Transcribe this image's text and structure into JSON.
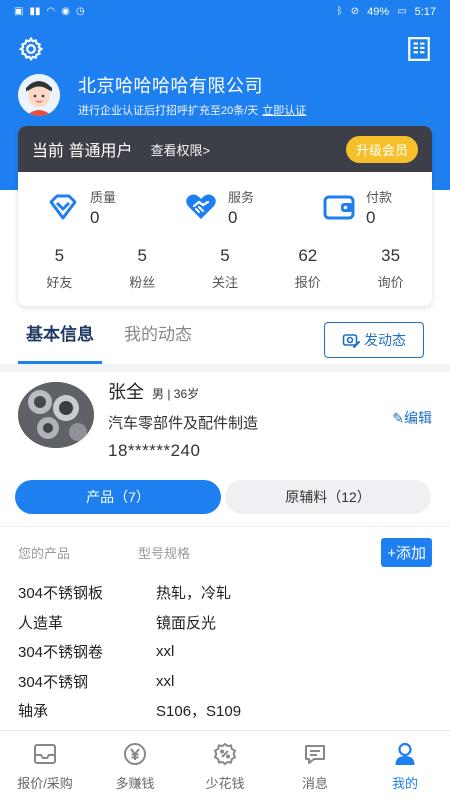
{
  "status_bar": {
    "battery": "49%",
    "time": "5:17"
  },
  "header": {
    "settings_icon": "gear-icon",
    "right_icon": "building-icon",
    "company_name": "北京哈哈哈哈有限公司",
    "subtitle": "进行企业认证后打招呼扩充至20条/天",
    "verify_link": "立即认证"
  },
  "membership": {
    "level_text": "当前 普通用户",
    "permissions_link": "查看权限>",
    "upgrade_label": "升级会员",
    "upgrade_color": "#f5c02a",
    "bar_color": "#3c3f48"
  },
  "ratings": [
    {
      "label": "质量",
      "value": "0",
      "icon": "diamond-icon"
    },
    {
      "label": "服务",
      "value": "0",
      "icon": "handshake-heart-icon"
    },
    {
      "label": "付款",
      "value": "0",
      "icon": "wallet-icon"
    }
  ],
  "counts": [
    {
      "value": "5",
      "label": "好友"
    },
    {
      "value": "5",
      "label": "粉丝"
    },
    {
      "value": "5",
      "label": "关注"
    },
    {
      "value": "62",
      "label": "报价"
    },
    {
      "value": "35",
      "label": "询价"
    }
  ],
  "tabs": {
    "basic_info": "基本信息",
    "my_feed": "我的动态",
    "post_button": "发动态"
  },
  "profile": {
    "name": "张全",
    "meta": "男 | 36岁",
    "industry": "汽车零部件及配件制造",
    "phone": "18******240",
    "edit_label": "编辑"
  },
  "segment": {
    "products": "产品（7）",
    "materials": "原辅料（12）"
  },
  "products_table": {
    "col_product": "您的产品",
    "col_spec": "型号规格",
    "add_label": "+添加",
    "rows": [
      {
        "name": "304不锈钢板",
        "spec": "热轧，冷轧"
      },
      {
        "name": "人造革",
        "spec": "镜面反光"
      },
      {
        "name": "304不锈钢卷",
        "spec": "xxl"
      },
      {
        "name": "304不锈钢",
        "spec": "xxl"
      },
      {
        "name": "轴承",
        "spec": "S106，S109"
      }
    ]
  },
  "tabbar": [
    {
      "label": "报价/采购",
      "icon": "inbox-icon"
    },
    {
      "label": "多赚钱",
      "icon": "yuan-coin-icon"
    },
    {
      "label": "少花钱",
      "icon": "discount-coin-icon"
    },
    {
      "label": "消息",
      "icon": "message-icon"
    },
    {
      "label": "我的",
      "icon": "user-icon"
    }
  ],
  "colors": {
    "primary": "#1e7ff0",
    "dark_text": "#1f3a63"
  }
}
